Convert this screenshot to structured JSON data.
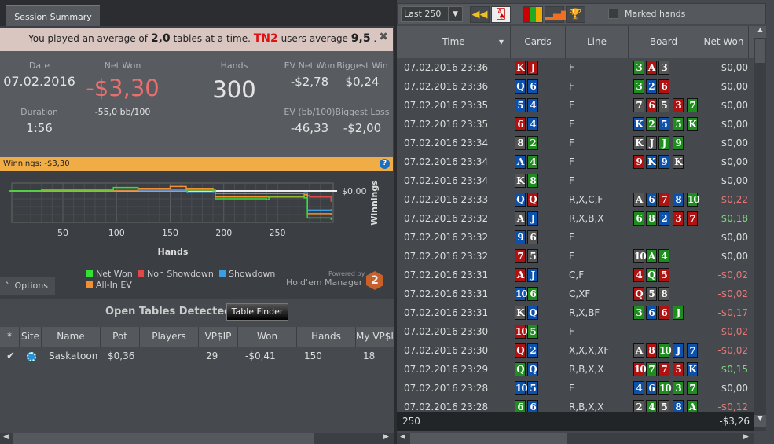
{
  "left": {
    "tab": "Session Summary",
    "banner": {
      "pre": "You played an average of",
      "tables": "2,0",
      "mid": "tables at a time.",
      "brand": "TN2",
      "post": "users average",
      "avg": "9,5",
      "end": ".",
      "close": "✖"
    },
    "stats": {
      "date_label": "Date",
      "date": "07.02.2016",
      "duration_label": "Duration",
      "duration": "1:56",
      "net_won_label": "Net Won",
      "net_won": "-$3,30",
      "bb100": "-55,0 bb/100",
      "hands_label": "Hands",
      "hands": "300",
      "ev_net_won_label": "EV Net Won",
      "ev_net_won": "-$2,78",
      "ev_bb100_label": "EV (bb/100)",
      "ev_bb100": "-46,33",
      "biggest_win_label": "Biggest Win",
      "biggest_win": "$0,24",
      "biggest_loss_label": "Biggest Loss",
      "biggest_loss": "-$2,00"
    },
    "winnings_bar": "Winnings: -$3,30",
    "options": "Options",
    "powered_by": "Powered by",
    "hem": "Hold'em Manager",
    "open_tables": {
      "title": "Open Tables Detected",
      "table_finder": "Table Finder",
      "columns": [
        "*",
        "Site",
        "Name",
        "Pot",
        "Players",
        "VP$IP",
        "Won",
        "Hands",
        "My VP$I"
      ],
      "rows": [
        {
          "checked": true,
          "name": "Saskatoon",
          "pot": "$0,36",
          "players": "",
          "vpip": "29",
          "won": "-$0,41",
          "hands": "150",
          "my_vpip": "18"
        }
      ]
    }
  },
  "chart_data": {
    "type": "line",
    "xlabel": "Hands",
    "ylabel": "Winnings",
    "xticks": [
      50,
      100,
      150,
      200,
      250
    ],
    "xlim": [
      0,
      300
    ],
    "ylim": [
      -3.6,
      0.9
    ],
    "yticks": [
      {
        "value": 0,
        "label": "$0,00"
      }
    ],
    "grid": true,
    "legend": "bottom",
    "series": [
      {
        "name": "Net Won",
        "color": "#33e033",
        "points": [
          [
            0,
            0
          ],
          [
            30,
            0.1
          ],
          [
            90,
            0.1
          ],
          [
            97,
            0.4
          ],
          [
            120,
            0.2
          ],
          [
            165,
            0.1
          ],
          [
            190,
            0
          ],
          [
            192,
            -0.9
          ],
          [
            210,
            -0.9
          ],
          [
            240,
            -1.0
          ],
          [
            242,
            -0.6
          ],
          [
            275,
            -0.8
          ],
          [
            278,
            -3.1
          ],
          [
            300,
            -3.3
          ]
        ]
      },
      {
        "name": "Non Showdown",
        "color": "#e04848",
        "points": [
          [
            0,
            0
          ],
          [
            50,
            0
          ],
          [
            100,
            0.05
          ],
          [
            190,
            0.05
          ],
          [
            192,
            -0.6
          ],
          [
            275,
            -0.5
          ],
          [
            280,
            -0.7
          ],
          [
            300,
            -1.25
          ]
        ]
      },
      {
        "name": "Showdown",
        "color": "#3a9ee0",
        "points": [
          [
            0,
            0
          ],
          [
            165,
            0
          ],
          [
            166,
            -0.2
          ],
          [
            190,
            -0.2
          ],
          [
            192,
            -0.3
          ],
          [
            275,
            -0.2
          ],
          [
            278,
            -2.2
          ],
          [
            290,
            -2.2
          ],
          [
            300,
            -2.1
          ]
        ]
      },
      {
        "name": "All-In EV",
        "color": "#f09030",
        "points": [
          [
            0,
            0
          ],
          [
            120,
            0.3
          ],
          [
            150,
            0.5
          ],
          [
            165,
            0.3
          ],
          [
            190,
            0.2
          ],
          [
            192,
            -0.7
          ],
          [
            275,
            -0.4
          ],
          [
            278,
            -2.6
          ],
          [
            300,
            -2.78
          ]
        ]
      }
    ]
  },
  "right": {
    "filter": "Last 250",
    "marked_hands": "Marked hands",
    "columns": [
      "Time",
      "Cards",
      "Line",
      "Board",
      "Net Won"
    ],
    "suit_colors": {
      "r": "#b01212",
      "b": "#0c52ad",
      "g": "#1f8c1f",
      "k": "#555555"
    },
    "rows": [
      {
        "time": "07.02.2016 23:36",
        "cards": [
          "Kr",
          "Jr"
        ],
        "line": "F",
        "board": [
          "3g",
          "Ar",
          "3k"
        ],
        "won": "$0,00"
      },
      {
        "time": "07.02.2016 23:36",
        "cards": [
          "Qb",
          "6b"
        ],
        "line": "F",
        "board": [
          "3g",
          "2b",
          "6r"
        ],
        "won": "$0,00"
      },
      {
        "time": "07.02.2016 23:35",
        "cards": [
          "5b",
          "4b"
        ],
        "line": "F",
        "board": [
          "7k",
          "6r",
          "5k",
          "3r",
          "7g"
        ],
        "won": "$0,00"
      },
      {
        "time": "07.02.2016 23:35",
        "cards": [
          "6r",
          "4b"
        ],
        "line": "F",
        "board": [
          "Kb",
          "2g",
          "5b",
          "5g",
          "Kg"
        ],
        "won": "$0,00"
      },
      {
        "time": "07.02.2016 23:34",
        "cards": [
          "8k",
          "2g"
        ],
        "line": "F",
        "board": [
          "Kk",
          "Jk",
          "Jg",
          "9g"
        ],
        "won": "$0,00"
      },
      {
        "time": "07.02.2016 23:34",
        "cards": [
          "Ab",
          "4g"
        ],
        "line": "F",
        "board": [
          "9r",
          "Kb",
          "9b",
          "Kk"
        ],
        "won": "$0,00"
      },
      {
        "time": "07.02.2016 23:34",
        "cards": [
          "Kk",
          "8g"
        ],
        "line": "F",
        "board": [],
        "won": "$0,00"
      },
      {
        "time": "07.02.2016 23:33",
        "cards": [
          "Qb",
          "Qr"
        ],
        "line": "R,X,C,F",
        "board": [
          "Ak",
          "6b",
          "7r",
          "8b",
          "10g"
        ],
        "won": "-$0,22"
      },
      {
        "time": "07.02.2016 23:32",
        "cards": [
          "Ak",
          "Jb"
        ],
        "line": "R,X,B,X",
        "board": [
          "6g",
          "8g",
          "2b",
          "3r",
          "7r"
        ],
        "won": "$0,18"
      },
      {
        "time": "07.02.2016 23:32",
        "cards": [
          "9b",
          "6k"
        ],
        "line": "F",
        "board": [],
        "won": "$0,00"
      },
      {
        "time": "07.02.2016 23:32",
        "cards": [
          "7r",
          "5k"
        ],
        "line": "F",
        "board": [
          "10k",
          "Ag",
          "4g"
        ],
        "won": "$0,00"
      },
      {
        "time": "07.02.2016 23:31",
        "cards": [
          "Ar",
          "Jb"
        ],
        "line": "C,F",
        "board": [
          "4r",
          "Qg",
          "5r"
        ],
        "won": "-$0,02"
      },
      {
        "time": "07.02.2016 23:31",
        "cards": [
          "10b",
          "6g"
        ],
        "line": "C,XF",
        "board": [
          "Qr",
          "5k",
          "8k"
        ],
        "won": "-$0,02"
      },
      {
        "time": "07.02.2016 23:31",
        "cards": [
          "Kk",
          "Qb"
        ],
        "line": "R,X,BF",
        "board": [
          "3g",
          "6b",
          "6r",
          "Jg"
        ],
        "won": "-$0,17"
      },
      {
        "time": "07.02.2016 23:30",
        "cards": [
          "10r",
          "5g"
        ],
        "line": "F",
        "board": [],
        "won": "-$0,02"
      },
      {
        "time": "07.02.2016 23:30",
        "cards": [
          "Qr",
          "2b"
        ],
        "line": "X,X,X,XF",
        "board": [
          "Ak",
          "8r",
          "10g",
          "Jb",
          "7b"
        ],
        "won": "-$0,02"
      },
      {
        "time": "07.02.2016 23:29",
        "cards": [
          "Qg",
          "Qb"
        ],
        "line": "R,B,X,X",
        "board": [
          "10r",
          "7g",
          "7r",
          "5r",
          "Kb"
        ],
        "won": "$0,15"
      },
      {
        "time": "07.02.2016 23:28",
        "cards": [
          "10b",
          "5b"
        ],
        "line": "F",
        "board": [
          "4b",
          "6b",
          "10g",
          "3g",
          "7g"
        ],
        "won": "$0,00"
      },
      {
        "time": "07.02.2016 23:28",
        "cards": [
          "6g",
          "6b"
        ],
        "line": "R,B,X,X",
        "board": [
          "2k",
          "4g",
          "5k",
          "8b",
          "Ag"
        ],
        "won": "-$0,12"
      }
    ],
    "footer": {
      "count": "250",
      "total": "-$3,26"
    }
  }
}
